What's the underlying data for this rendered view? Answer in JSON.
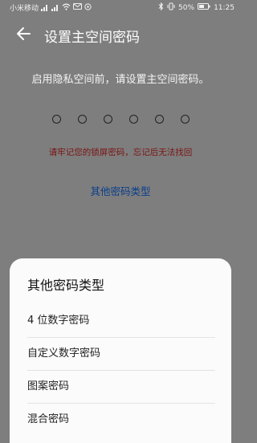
{
  "status_bar": {
    "carrier": "小米移动",
    "battery": "50%",
    "time": "11:25"
  },
  "header": {
    "title": "设置主空间密码"
  },
  "main": {
    "prompt": "启用隐私空间前，请设置主空间密码。",
    "warning": "请牢记您的锁屏密码，忘记后无法找回",
    "other_link": "其他密码类型",
    "pin_dots": 6
  },
  "sheet": {
    "title": "其他密码类型",
    "options": [
      "4 位数字密码",
      "自定义数字密码",
      "图案密码",
      "混合密码"
    ]
  },
  "colors": {
    "link": "#0b3e8a",
    "warning": "#7a1414",
    "overlay": "#7e7e7e"
  }
}
